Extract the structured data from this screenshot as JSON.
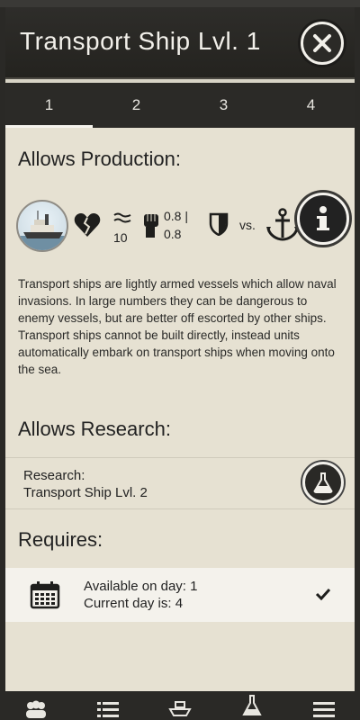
{
  "header": {
    "title": "Transport Ship Lvl. 1"
  },
  "tabs": [
    {
      "label": "1",
      "active": true
    },
    {
      "label": "2",
      "active": false
    },
    {
      "label": "3",
      "active": false
    },
    {
      "label": "4",
      "active": false
    }
  ],
  "production": {
    "heading": "Allows Production:",
    "stats": {
      "hitpoints_icon": "broken-heart-icon",
      "speed_icon": "waves-icon",
      "speed_value": "10",
      "strength_icon": "fist-icon",
      "strength_line1": "0.8 |",
      "strength_line2": "0.8",
      "defense_icon": "shield-icon",
      "vs_label": "vs.",
      "target_icon": "anchor-icon"
    },
    "description": "Transport ships are lightly armed vessels which allow naval invasions. In large numbers they can be dangerous to enemy vessels, but are better off escorted by other ships. Transport ships cannot be built directly, instead units automatically embark on transport ships when moving onto the sea."
  },
  "research": {
    "heading": "Allows Research:",
    "label": "Research:",
    "item": "Transport Ship Lvl. 2"
  },
  "requires": {
    "heading": "Requires:",
    "line1": "Available on day: 1",
    "line2": "Current day is: 4",
    "met": true
  },
  "bottom_nav": [
    {
      "icon": "people-icon"
    },
    {
      "icon": "list-icon"
    },
    {
      "icon": "ship-icon"
    },
    {
      "icon": "flask-icon"
    },
    {
      "icon": "menu-icon"
    }
  ],
  "colors": {
    "header_bg": "#2b2a27",
    "panel_bg": "#e6e1d2",
    "accent_light": "#f4f2ec"
  }
}
